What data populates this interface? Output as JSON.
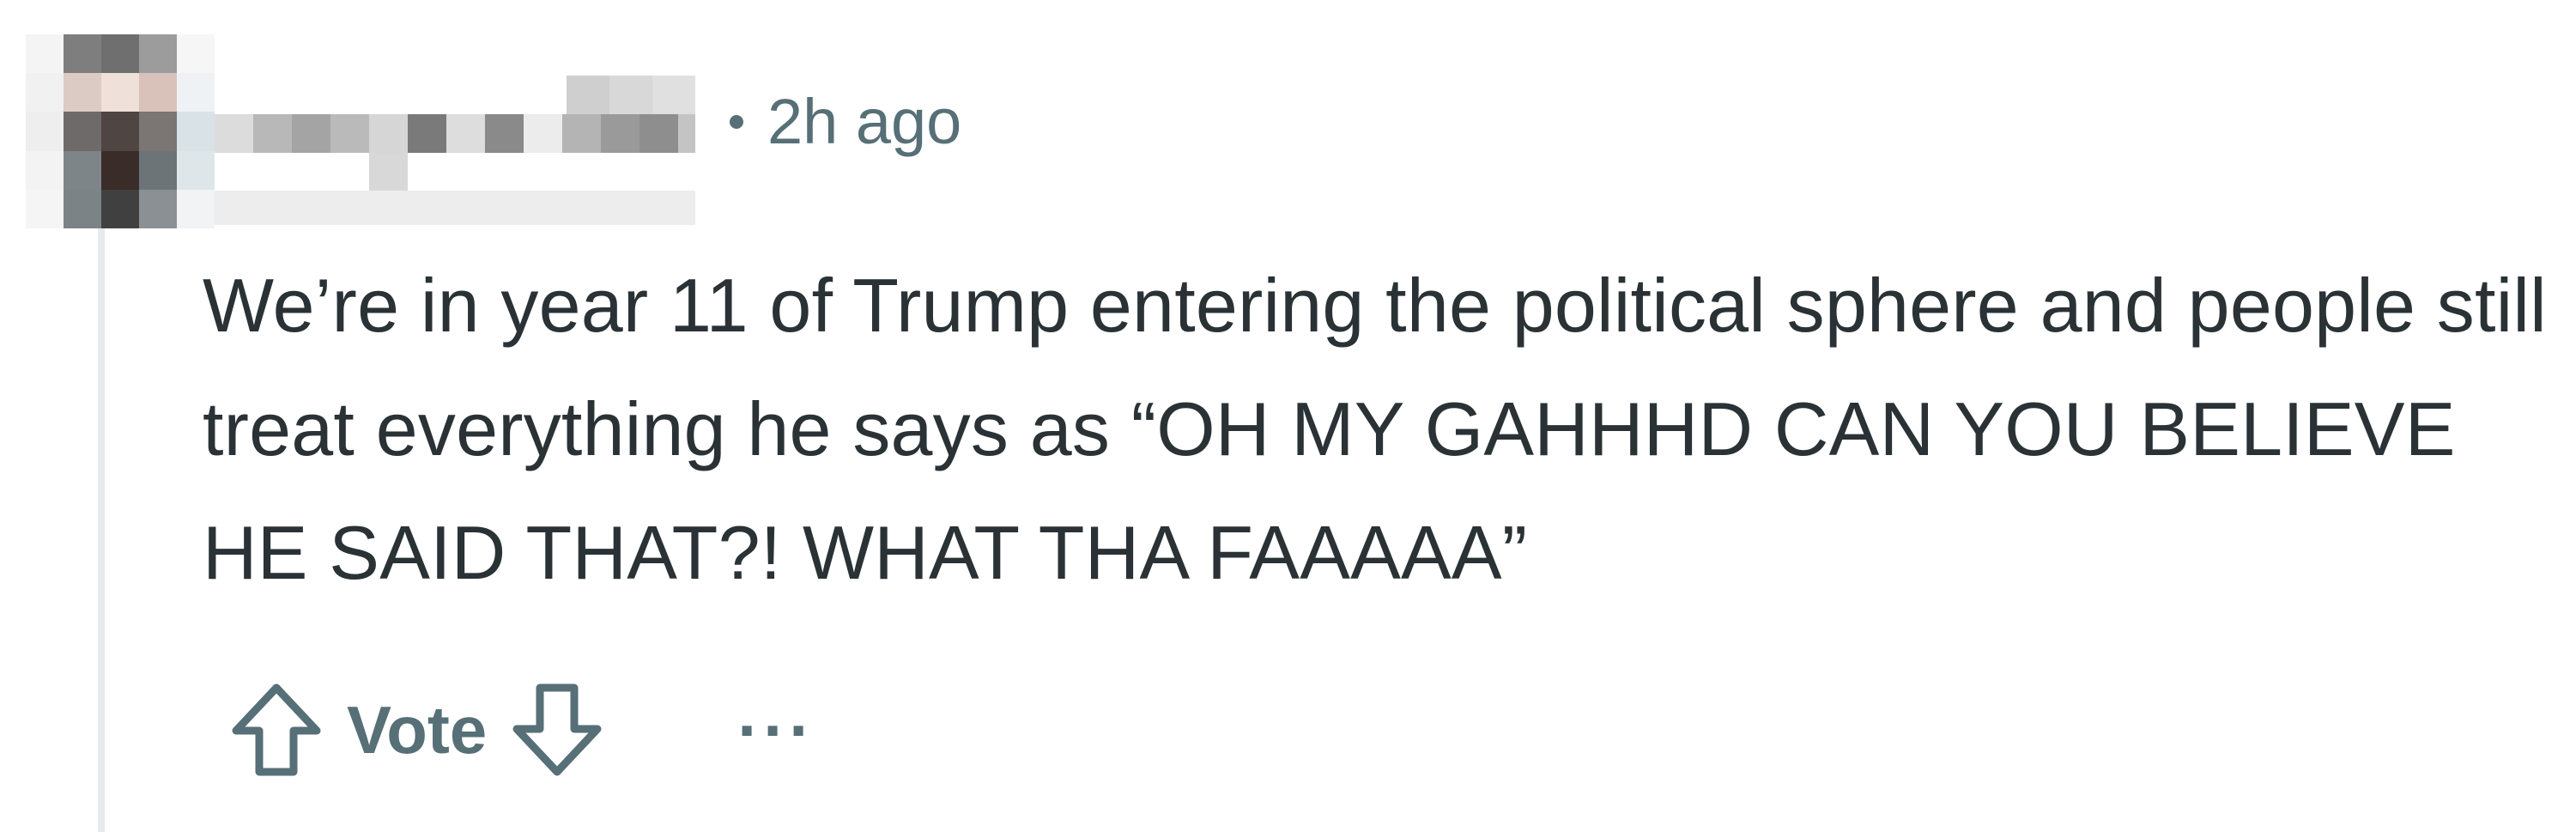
{
  "comment": {
    "author_avatar_icon": "pixelated-avatar-icon",
    "author_name_redacted": "",
    "separator": "•",
    "timestamp": "2h ago",
    "body": "We’re in year 11 of Trump entering the political sphere and people still treat everything he says as “OH MY GAHHHD CAN YOU BELIEVE HE SAID THAT?! WHAT THA FAAAAA”",
    "actions": {
      "upvote_icon": "arrow-up-outline-icon",
      "vote_label": "Vote",
      "downvote_icon": "arrow-down-outline-icon",
      "more_label": "···"
    }
  },
  "colors": {
    "meta_text": "#576f76",
    "body_text": "#2a3236",
    "thread_line": "#e5ebee",
    "background": "#ffffff"
  }
}
